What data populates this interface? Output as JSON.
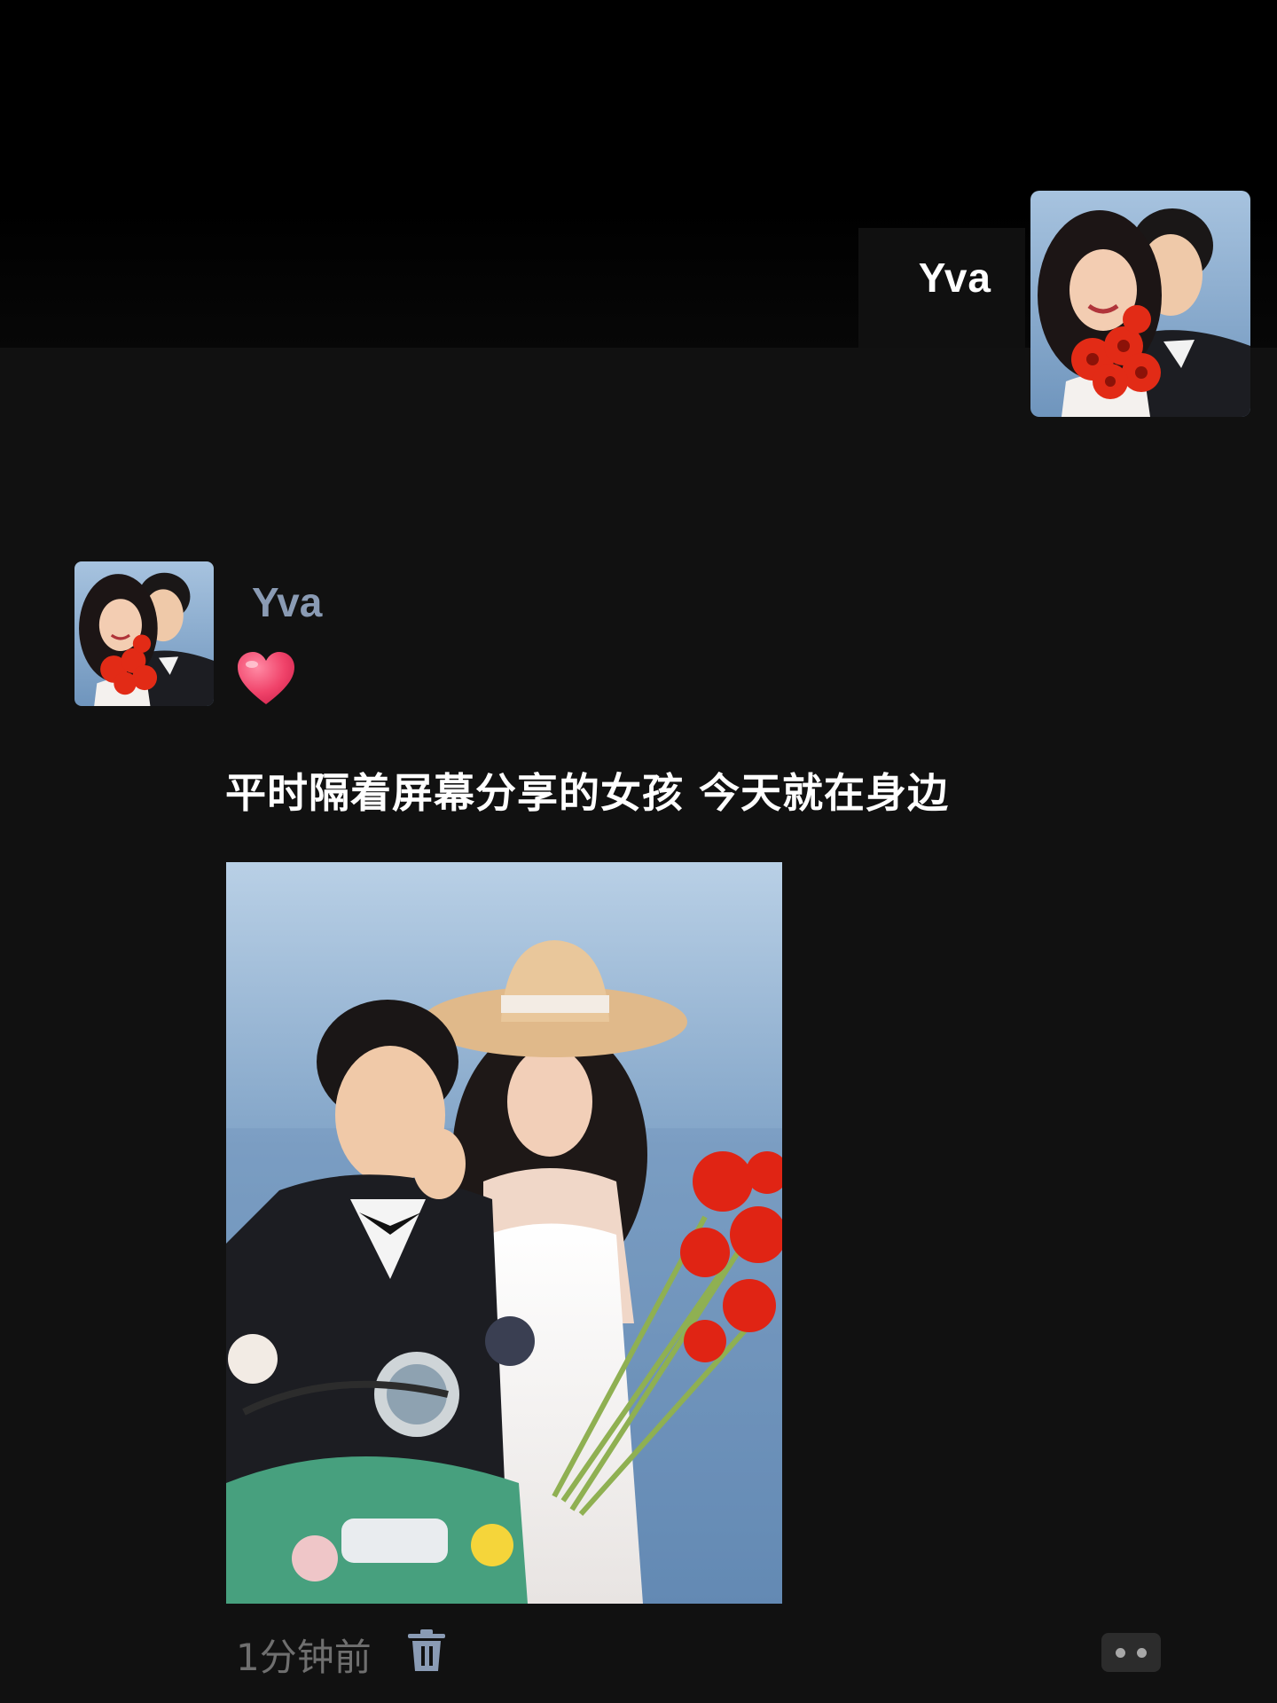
{
  "cover": {
    "username": "Yva",
    "avatar_icon": "couple-photo-avatar"
  },
  "post": {
    "author": "Yva",
    "emoji_icon": "heart-emoji",
    "text": "平时隔着屏幕分享的女孩 今天就在身边",
    "photo_icon": "couple-scooter-photo",
    "time": "1分钟前",
    "delete_icon": "trash-icon",
    "more_icon": "more-dots-icon"
  },
  "colors": {
    "background": "#111111",
    "author_name": "#8a9bb4",
    "timestamp": "#6f6f6f",
    "heart": "#f0436a"
  }
}
